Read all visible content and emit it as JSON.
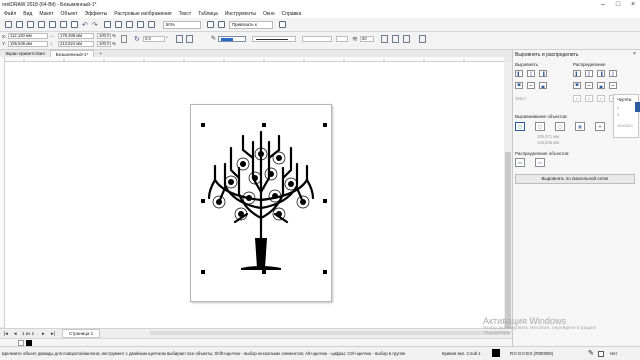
{
  "window": {
    "title": "orelDRAW 2018 (64-Bit) - Безымянный-1*"
  },
  "menu": [
    "Файл",
    "Вид",
    "Макет",
    "Объект",
    "Эффекты",
    "Растровые изображения",
    "Текст",
    "Таблица",
    "Инструменты",
    "Окно",
    "Справка"
  ],
  "toolbar": {
    "zoom": "50%",
    "snap": "Привязать к"
  },
  "properties": {
    "x": "112,130 мм",
    "y": "155,546 мм",
    "width": "178,489 мм",
    "height": "213,624 мм",
    "scale_x": "100,0",
    "scale_y": "100,0",
    "rotation": "0,0",
    "outline_value": "50",
    "pct": "%"
  },
  "tabs": {
    "welcome": "Экран приветствия",
    "document": "Безымянный-1*",
    "add": "+"
  },
  "docker": {
    "title": "Выровнять и распределить",
    "align_label": "Выровнять",
    "distribute_label": "Распределение",
    "text_label": "Текст",
    "align_objects_label": "Выравнивание объектов:",
    "coord_x": "105,071 мм",
    "coord_y": "148,505 мм",
    "distribute_objects_label": "Распределение объектов:",
    "pixel_grid_button": "Выровнять по пиксельной сетке",
    "side_tab_label": "Чертёж",
    "side_values": [
      "0",
      "0",
      "4000000"
    ]
  },
  "page_nav": {
    "page_label": "Страница 1",
    "counter": "1 из 1"
  },
  "status": {
    "message": "Щелкните объект дважды для поворота/наклона; инструмент с двойным щелчком выбирает все объекты; Shift+щелчок - выбор нескольких элементов; Alt+щелчок - цифры; Ctrl+щелчок - выбор в группе",
    "curve": "Кривая вкл. Слой 1",
    "fill_info": "R:0 G:0 B:0 (#000000)",
    "outline": "Нет"
  },
  "watermark": {
    "line1": "Активация Windows",
    "line2": "Чтобы активировать Windows, перейдите в раздел",
    "line3": "\"Параметры\"."
  },
  "colors": {
    "accent": "#2c5aa0",
    "panel_bg": "#f6f6f6",
    "canvas_bg": "#ffffff"
  }
}
